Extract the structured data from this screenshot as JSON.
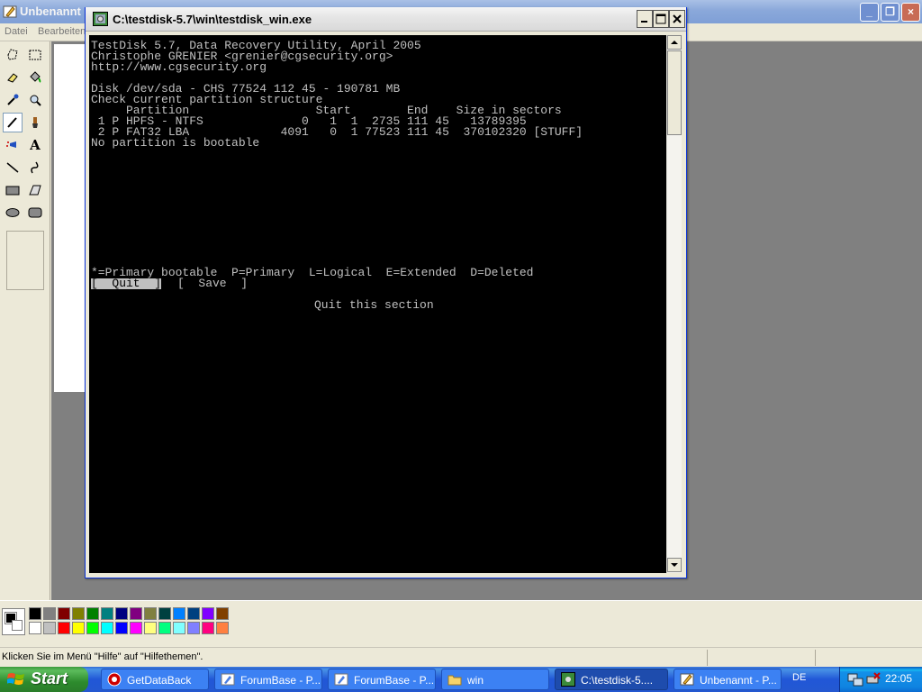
{
  "paint": {
    "title": "Unbenannt",
    "menu": [
      "Datei",
      "Bearbeiten"
    ],
    "status_text": "Klicken Sie im Menü \"Hilfe\" auf \"Hilfethemen\".",
    "palette_top": [
      "#000000",
      "#808080",
      "#800000",
      "#808000",
      "#008000",
      "#008080",
      "#000080",
      "#800080",
      "#808040",
      "#004040",
      "#0080ff",
      "#004080",
      "#8000ff",
      "#804000"
    ],
    "palette_bottom": [
      "#ffffff",
      "#c0c0c0",
      "#ff0000",
      "#ffff00",
      "#00ff00",
      "#00ffff",
      "#0000ff",
      "#ff00ff",
      "#ffff80",
      "#00ff80",
      "#80ffff",
      "#8080ff",
      "#ff0080",
      "#ff8040"
    ]
  },
  "console": {
    "title": "C:\\testdisk-5.7\\win\\testdisk_win.exe",
    "lines": [
      "TestDisk 5.7, Data Recovery Utility, April 2005",
      "Christophe GRENIER <grenier@cgsecurity.org>",
      "http://www.cgsecurity.org",
      "",
      "Disk /dev/sda - CHS 77524 112 45 - 190781 MB",
      "Check current partition structure",
      "     Partition                  Start        End    Size in sectors",
      " 1 P HPFS - NTFS              0   1  1  2735 111 45   13789395",
      " 2 P FAT32 LBA             4091   0  1 77523 111 45  370102320 [STUFF]",
      "No partition is bootable"
    ],
    "legend": "*=Primary bootable  P=Primary  L=Logical  E=Extended  D=Deleted",
    "menu_quit": "[  Quit  ]",
    "menu_save": "[  Save  ]",
    "hint": "Quit this section"
  },
  "taskbar": {
    "start": "Start",
    "tasks": [
      {
        "label": "GetDataBack",
        "icon": "getdataback-icon",
        "active": false
      },
      {
        "label": "ForumBase - P...",
        "icon": "browser-icon",
        "active": false
      },
      {
        "label": "ForumBase - P...",
        "icon": "browser-icon",
        "active": false
      },
      {
        "label": "win",
        "icon": "folder-icon",
        "active": false
      },
      {
        "label": "C:\\testdisk-5....",
        "icon": "console-icon",
        "active": true
      },
      {
        "label": "Unbenannt - P...",
        "icon": "paint-icon",
        "active": false
      }
    ],
    "language": "DE",
    "clock": "22:05"
  }
}
